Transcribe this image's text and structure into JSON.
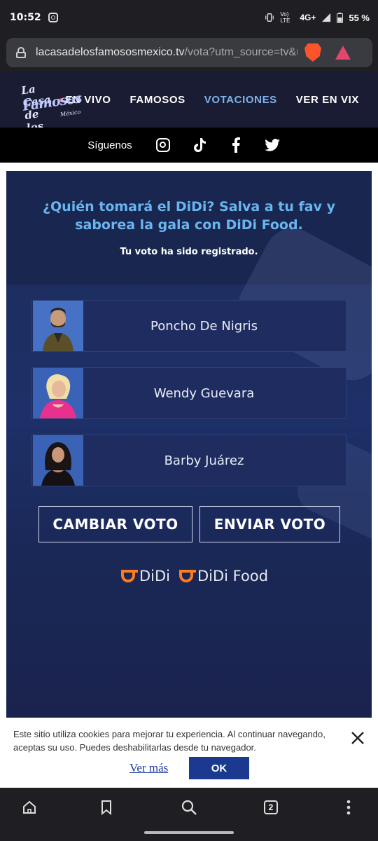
{
  "status_bar": {
    "time": "10:52",
    "network": "4G+",
    "volte": "Vo) LTE",
    "battery": "55 %"
  },
  "browser": {
    "url_host": "lacasadelosfamososmexico.tv",
    "url_path": "/vota?utm_source=tv&utm_me",
    "tab_count": "2"
  },
  "site": {
    "logo": {
      "line1": "La Casa de los",
      "line2": "Famosos",
      "line3": "México"
    },
    "nav": [
      {
        "label": "EN VIVO"
      },
      {
        "label": "FAMOSOS"
      },
      {
        "label": "VOTACIONES"
      },
      {
        "label": "VER EN VIX"
      }
    ],
    "social_label": "Síguenos",
    "social_icons": [
      "instagram-icon",
      "tiktok-icon",
      "facebook-icon",
      "twitter-icon"
    ]
  },
  "vote": {
    "question": "¿Quién tomará el DiDi? Salva a tu fav y saborea la gala con DiDi Food.",
    "confirmation": "Tu voto ha sido registrado.",
    "candidates": [
      {
        "name": "Poncho De Nigris"
      },
      {
        "name": "Wendy Guevara"
      },
      {
        "name": "Barby Juárez"
      }
    ],
    "change_button": "CAMBIAR VOTO",
    "send_button": "ENVIAR VOTO",
    "sponsors": {
      "didi": "DiDi",
      "didi_food": "DiDi Food"
    }
  },
  "cookie_banner": {
    "text": "Este sitio utiliza cookies para mejorar tu experiencia. Al continuar navegando, aceptas su uso. Puedes deshabilitarlas desde tu navegador.",
    "more_link": "Ver más",
    "ok_button": "OK"
  },
  "colors": {
    "accent_blue": "#69b5f0",
    "nav_active": "#7fb2ee",
    "didi_orange": "#fc7c1f",
    "ok_button": "#1b3a8f"
  }
}
